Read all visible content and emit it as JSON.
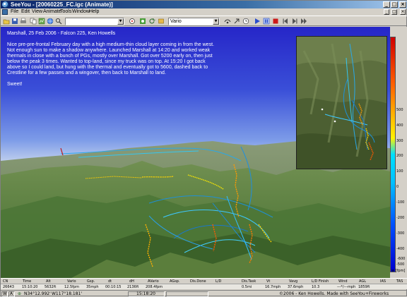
{
  "window": {
    "title": "SeeYou - [20060225_FC.igc (Animate)]",
    "minimize_glyph": "_",
    "maximize_glyph": "□",
    "close_glyph": "×"
  },
  "menubar": {
    "items": [
      "File",
      "Edit",
      "View",
      "Animate",
      "Tools",
      "Window",
      "Help"
    ],
    "mdi_buttons": [
      "_",
      "□",
      "×"
    ]
  },
  "toolbar": {
    "dropdown_left": "",
    "dropdown_right": "Vario",
    "icons": [
      "open-icon",
      "save-icon",
      "print-icon",
      "copy-icon",
      "map-icon",
      "globe-icon",
      "find-icon",
      "zoom-icon",
      "target-icon",
      "refresh-icon",
      "settings-icon",
      "camera-icon",
      "follow-icon",
      "clock-icon",
      "play-icon",
      "pause-icon",
      "stop-icon",
      "step-back-icon",
      "step-forward-icon",
      "fast-forward-icon"
    ],
    "pause_color": "#2a4dcc",
    "stop_color": "#cc1a1a"
  },
  "description": {
    "title": "Marshall, 25 Feb 2006 - Falcon 225, Ken Howells",
    "body": "Nice pre-pre-frontal February day with a high medium-thin cloud layer coming in from the west.  Not enough sun to make a shadow anywhere.  Launched Marshall at 14:20 and worked weak thermals in close with a bunch of PGs, mostly over Marshall.  Got over 5200 early on, then just below the peak 3 times.  Wanted to top-land, since my truck was on top.  At 15:20 I got back above so I could land, but hung with the thermal and eventually got to 5600, dashed back to Crestline for a few passes and a wingover, then back to Marshall to land.",
    "closing": "Sweet!"
  },
  "scale": {
    "ticks": [
      "500",
      "400",
      "300",
      "200",
      "100",
      "0",
      "-100",
      "-200",
      "-300",
      "-400",
      "-500",
      "-600"
    ],
    "unit": "w [fpm]",
    "colors": [
      "#d00000",
      "#ff6000",
      "#ffcc00",
      "#00e0ff",
      "#0050ff",
      "#0000d0"
    ]
  },
  "table": {
    "headers": [
      "CN",
      "Time",
      "Alt",
      "Vario",
      "Gsp.",
      "dt",
      "dH",
      "AVario",
      "AGsp.",
      "Dis.Done",
      "L/D",
      "Dis.Task",
      "Vt",
      "Vavg",
      "L/D Finish",
      "Wind",
      "AGL",
      "IAS",
      "TAS"
    ],
    "values": [
      "26643",
      "15:10:20",
      "5632ft",
      "12.5fpm",
      "35mph",
      "00:10:15",
      "2136ft",
      "208.4fpm",
      "",
      "",
      "",
      "0.5mi",
      "16.7mph",
      "37.6mph",
      "10.3",
      "---*/---mph",
      "1859ft",
      "",
      ""
    ]
  },
  "status": {
    "w": "W",
    "a": "A",
    "lat": "N34°12.992'",
    "lon": "W117°18.181'",
    "time": "15:18:20",
    "copyright": "©2006 - Ken Howells. Made with SeeYou+Fireworks"
  }
}
